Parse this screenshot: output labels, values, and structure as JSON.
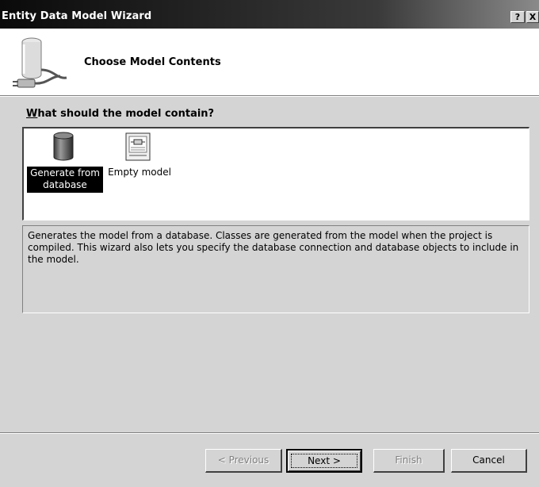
{
  "window": {
    "title": "Entity Data Model Wizard",
    "help_glyph": "?",
    "close_glyph": "X"
  },
  "header": {
    "title": "Choose Model Contents",
    "icon": "database-plug-icon"
  },
  "question": {
    "accesskey": "W",
    "rest": "hat should the model contain?"
  },
  "options": [
    {
      "label": "Generate from\ndatabase",
      "icon": "database-cylinder-icon",
      "selected": true
    },
    {
      "label": "Empty model",
      "icon": "empty-model-document-icon",
      "selected": false
    }
  ],
  "description": "Generates the model from a database. Classes are generated from the model when the project is compiled.  This wizard also lets you specify the database connection and database objects to include in the model.",
  "buttons": {
    "previous": "< Previous",
    "next": "Next >",
    "finish": "Finish",
    "cancel": "Cancel"
  },
  "colors": {
    "selection_bg": "#000000",
    "selection_text": "#ffffff",
    "disabled_text": "#808080",
    "dialog_bg": "#d4d4d4"
  }
}
